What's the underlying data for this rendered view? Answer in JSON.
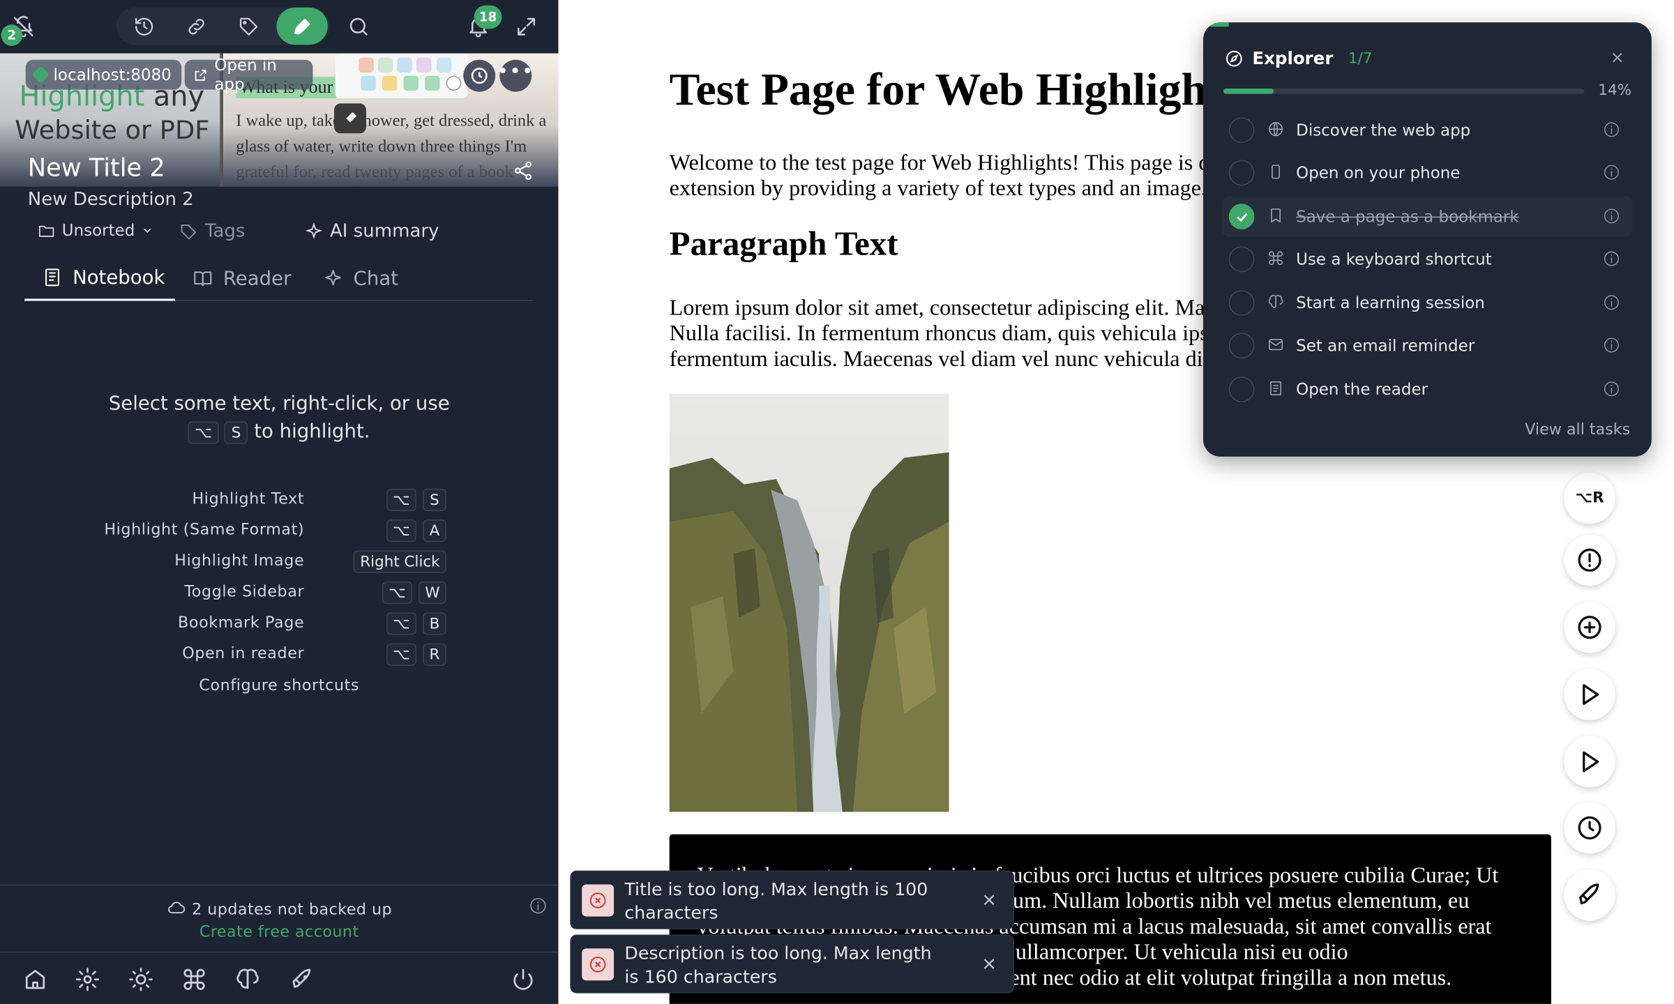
{
  "sidebar": {
    "topbar": {
      "notifications_count": "18",
      "status_badge": "2"
    },
    "preview": {
      "logo_highlight": "Highlight",
      "logo_any": " any",
      "logo_line2": "Website or PDF",
      "site_chip": "localhost:8080",
      "open_in_app": "Open in app",
      "snippet_heading": "What is your",
      "snippet_line1": "I wake up, take a shower, get dressed, drink a",
      "snippet_line2": "glass of water, write down three things I'm",
      "snippet_line3": "grateful for, read twenty pages of a book"
    },
    "title": "New Title 2",
    "description": "New Description 2",
    "meta": {
      "folder": "Unsorted",
      "tags": "Tags",
      "ai_summary": "AI summary"
    },
    "tabs": [
      "Notebook",
      "Reader",
      "Chat"
    ],
    "hint_line1": "Select some text, right-click, or use",
    "hint_line2": "to highlight.",
    "hint_keys": [
      "⌥",
      "S"
    ],
    "shortcuts": [
      {
        "label": "Highlight Text",
        "keys": [
          "⌥",
          "S"
        ]
      },
      {
        "label": "Highlight (Same Format)",
        "keys": [
          "⌥",
          "A"
        ]
      },
      {
        "label": "Highlight Image",
        "keys": [
          "Right Click"
        ]
      },
      {
        "label": "Toggle Sidebar",
        "keys": [
          "⌥",
          "W"
        ]
      },
      {
        "label": "Bookmark Page",
        "keys": [
          "⌥",
          "B"
        ]
      },
      {
        "label": "Open in reader",
        "keys": [
          "⌥",
          "R"
        ]
      }
    ],
    "configure_shortcuts": "Configure shortcuts",
    "backup_status": "2 updates not backed up",
    "create_account": "Create free account"
  },
  "page": {
    "h1": "Test Page for Web Highlights",
    "intro_line1": "Welcome to the test page for Web Highlights! This page is designed to test the",
    "intro_line2": "extension by providing a variety of text types and an image.",
    "h2": "Paragraph Text",
    "para_line1": "Lorem ipsum dolor sit amet, consectetur adipiscing elit. Mauris at magna non est",
    "para_line2": "Nulla facilisi. In fermentum rhoncus diam, quis vehicula ipsum lacinia vel. Donec",
    "para_line3": "fermentum iaculis. Maecenas vel diam vel nunc vehicula dictum.",
    "dark_line1": "Vestibulum ante ipsum primis in faucibus orci luctus et ultrices posuere cubilia Curae; Ut",
    "dark_line2": "vel ipsum ac lectus feugiat vestibulum. Nullam lobortis nibh vel metus elementum, eu",
    "dark_line3": "volutpat tellus finibus. Maecenas accumsan mi a lacus malesuada, sit amet convallis erat",
    "dark_line4": "efficitur. Integer id lacus dignissim ullamcorper. Ut vehicula nisi eu odio",
    "dark_line5": "ullamcorper, vel efficitur mi. Praesent nec odio at elit volutpat fringilla a non metus."
  },
  "fabs": {
    "reader_shortcut": "⌥R"
  },
  "explorer": {
    "title": "Explorer",
    "count": "1/7",
    "progress_percent": 14,
    "progress_label": "14%",
    "tasks": [
      {
        "label": "Discover the web app",
        "icon": "globe-icon",
        "done": false
      },
      {
        "label": "Open on your phone",
        "icon": "phone-icon",
        "done": false
      },
      {
        "label": "Save a page as a bookmark",
        "icon": "bookmark-icon",
        "done": true
      },
      {
        "label": "Use a keyboard shortcut",
        "icon": "command-icon",
        "done": false
      },
      {
        "label": "Start a learning session",
        "icon": "brain-icon",
        "done": false
      },
      {
        "label": "Set an email reminder",
        "icon": "mail-icon",
        "done": false
      },
      {
        "label": "Open the reader",
        "icon": "document-icon",
        "done": false
      }
    ],
    "view_all": "View all tasks"
  },
  "toasts": [
    "Title is too long. Max length is 100 characters",
    "Description is too long. Max length is 160 characters"
  ],
  "colors": {
    "accent": "#3fa86a",
    "sidebar_bg": "#1c2331",
    "panel_bg": "#1f2735",
    "error": "#d33b3b"
  }
}
